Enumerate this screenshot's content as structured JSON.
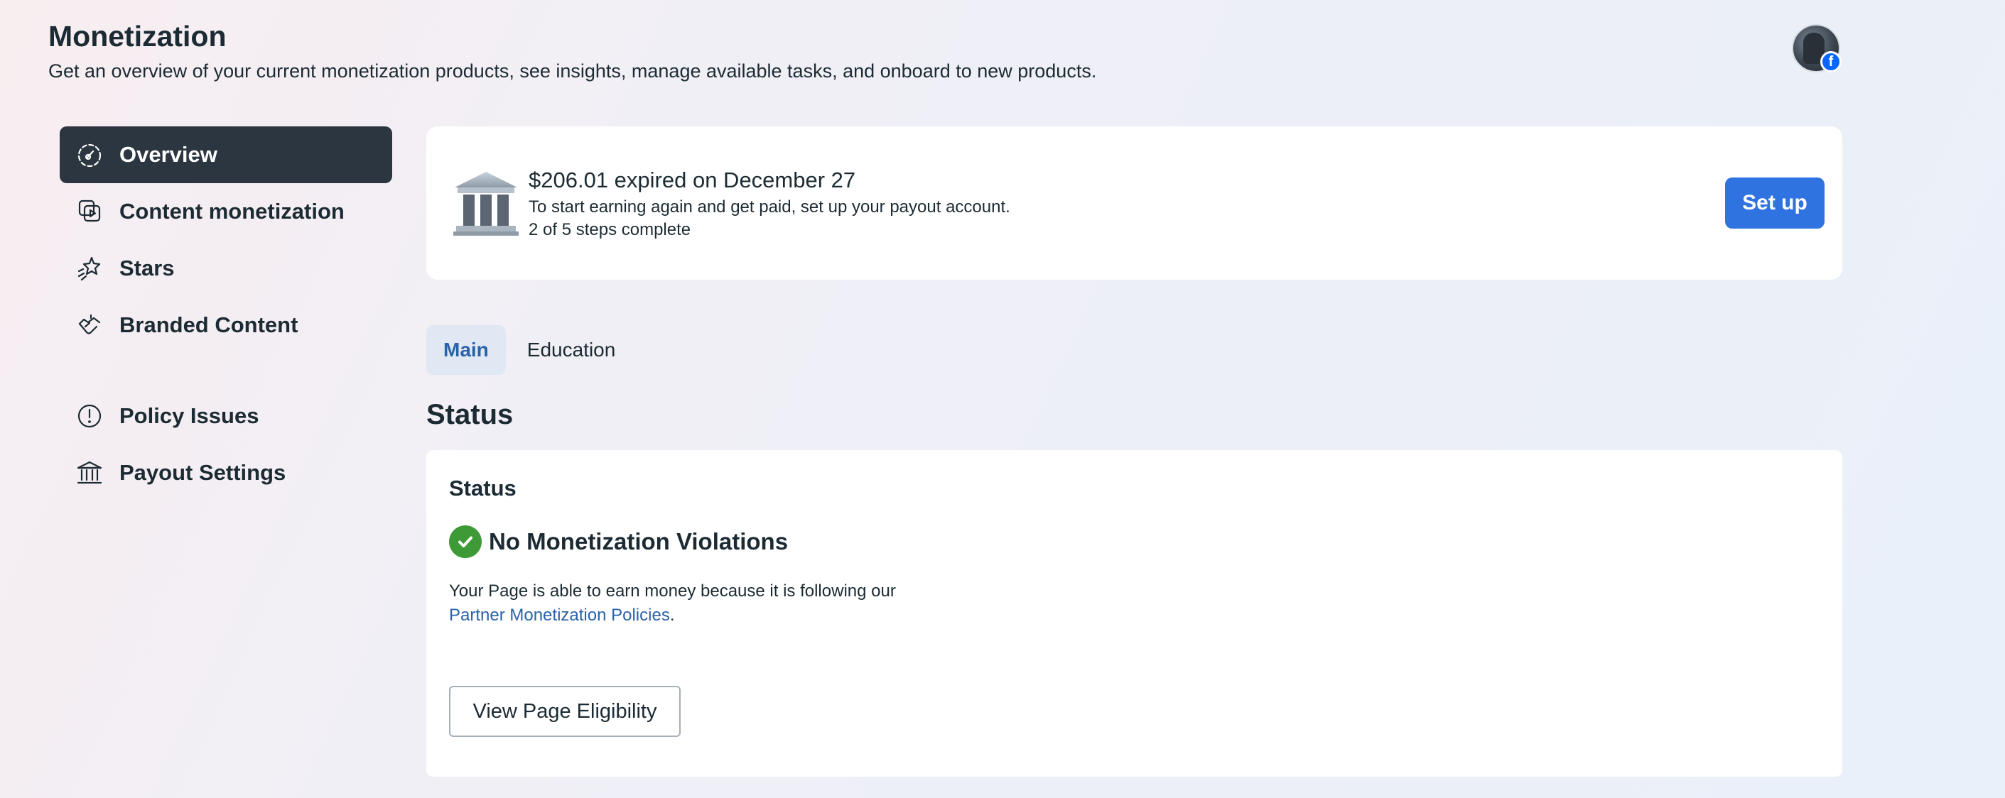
{
  "header": {
    "title": "Monetization",
    "subtitle": "Get an overview of your current monetization products, see insights, manage available tasks, and onboard to new products."
  },
  "sidebar": {
    "items": [
      {
        "label": "Overview",
        "icon": "gauge-icon",
        "active": true
      },
      {
        "label": "Content monetization",
        "icon": "video-copy-icon"
      },
      {
        "label": "Stars",
        "icon": "stars-icon"
      },
      {
        "label": "Branded Content",
        "icon": "handshake-icon"
      },
      {
        "label": "Policy Issues",
        "icon": "alert-circle-icon"
      },
      {
        "label": "Payout Settings",
        "icon": "bank-icon"
      }
    ]
  },
  "payout": {
    "headline": "$206.01 expired on December 27",
    "description": "To start earning again and get paid, set up your payout account.",
    "steps": "2 of 5 steps complete",
    "button_label": "Set up",
    "illustration": "bank-building-icon"
  },
  "tabs": [
    {
      "label": "Main",
      "active": true
    },
    {
      "label": "Education"
    }
  ],
  "status_section": {
    "title": "Status",
    "card_title": "Status",
    "status_label": "No Monetization Violations",
    "description_prefix": "Your Page is able to earn money because it is following our",
    "link_label": "Partner Monetization Policies",
    "description_suffix": ".",
    "button_label": "View Page Eligibility",
    "status_icon": "check-circle-icon"
  },
  "colors": {
    "primary_button": "#2f73e0",
    "active_nav": "#2b3641",
    "link": "#2a62a9",
    "success": "#3d9a36"
  }
}
